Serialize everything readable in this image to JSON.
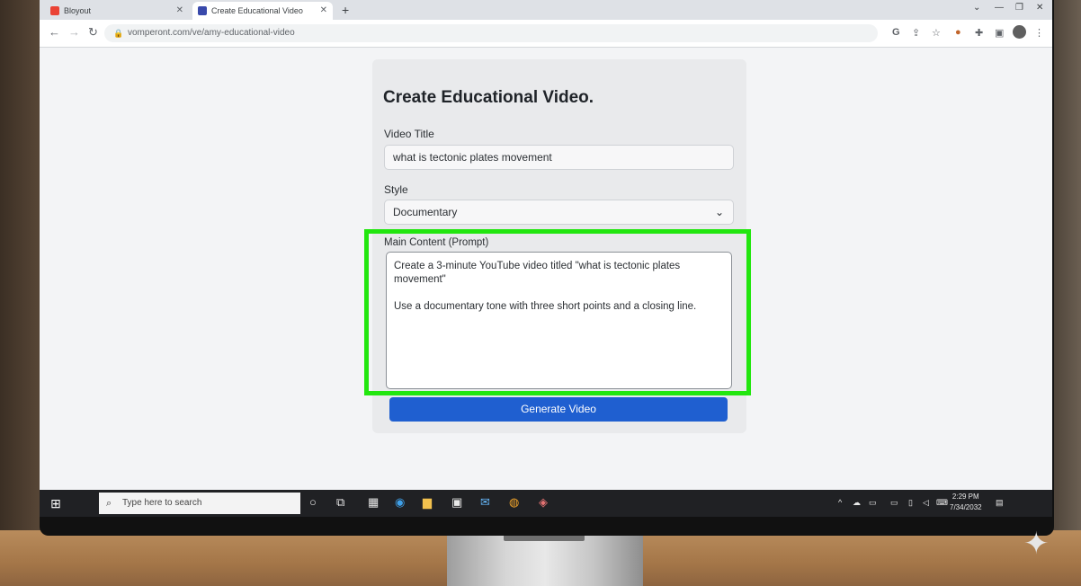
{
  "browser": {
    "tabs": [
      {
        "label": "Bloyout",
        "active": false
      },
      {
        "label": "Create Educational Video",
        "active": true
      }
    ],
    "new_tab": "+",
    "close": "✕",
    "url": "vomperont.com/ve/amy-educational-video"
  },
  "form": {
    "title": "Create Educational Video.",
    "video_title_label": "Video Title",
    "video_title_value": "what is tectonic plates movement",
    "style_label": "Style",
    "style_value": "Documentary",
    "content_label": "Main Content (Prompt)",
    "content_line1": "Create a 3-minute YouTube video titled \"what is tectonic plates movement\"",
    "content_line2": "Use a documentary tone with three short points and a closing line.",
    "generate_label": "Generate Video"
  },
  "taskbar": {
    "search_placeholder": "Type here to search",
    "time": "2:29 PM",
    "date": "7/34/2032"
  },
  "colors": {
    "accent": "#1f5fd0",
    "highlight": "#22e60f"
  }
}
